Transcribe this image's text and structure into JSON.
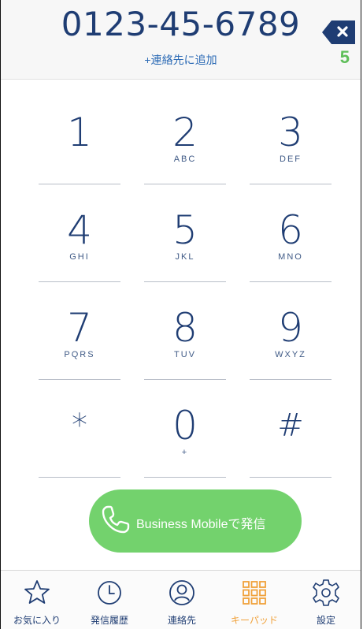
{
  "dialer": {
    "number": "0123-45-6789",
    "add_contact": "+連絡先に追加",
    "counter": "5"
  },
  "keys": [
    {
      "digit": "1",
      "letters": ""
    },
    {
      "digit": "2",
      "letters": "ABC"
    },
    {
      "digit": "3",
      "letters": "DEF"
    },
    {
      "digit": "4",
      "letters": "GHI"
    },
    {
      "digit": "5",
      "letters": "JKL"
    },
    {
      "digit": "6",
      "letters": "MNO"
    },
    {
      "digit": "7",
      "letters": "PQRS"
    },
    {
      "digit": "8",
      "letters": "TUV"
    },
    {
      "digit": "9",
      "letters": "WXYZ"
    },
    {
      "digit": "*",
      "letters": ""
    },
    {
      "digit": "0",
      "letters": "+"
    },
    {
      "digit": "#",
      "letters": ""
    }
  ],
  "call_button": {
    "label": "Business Mobileで発信",
    "icon": "phone-icon",
    "color": "#73d26d"
  },
  "tabs": [
    {
      "label": "お気に入り",
      "icon": "star-icon"
    },
    {
      "label": "発信履歴",
      "icon": "clock-icon"
    },
    {
      "label": "連絡先",
      "icon": "contact-icon"
    },
    {
      "label": "キーパッド",
      "icon": "keypad-icon",
      "active": true
    },
    {
      "label": "設定",
      "icon": "gear-icon"
    }
  ],
  "colors": {
    "primary_text": "#1f3d73",
    "accent_green": "#5fbf5a",
    "active_tab": "#f0a13a"
  }
}
